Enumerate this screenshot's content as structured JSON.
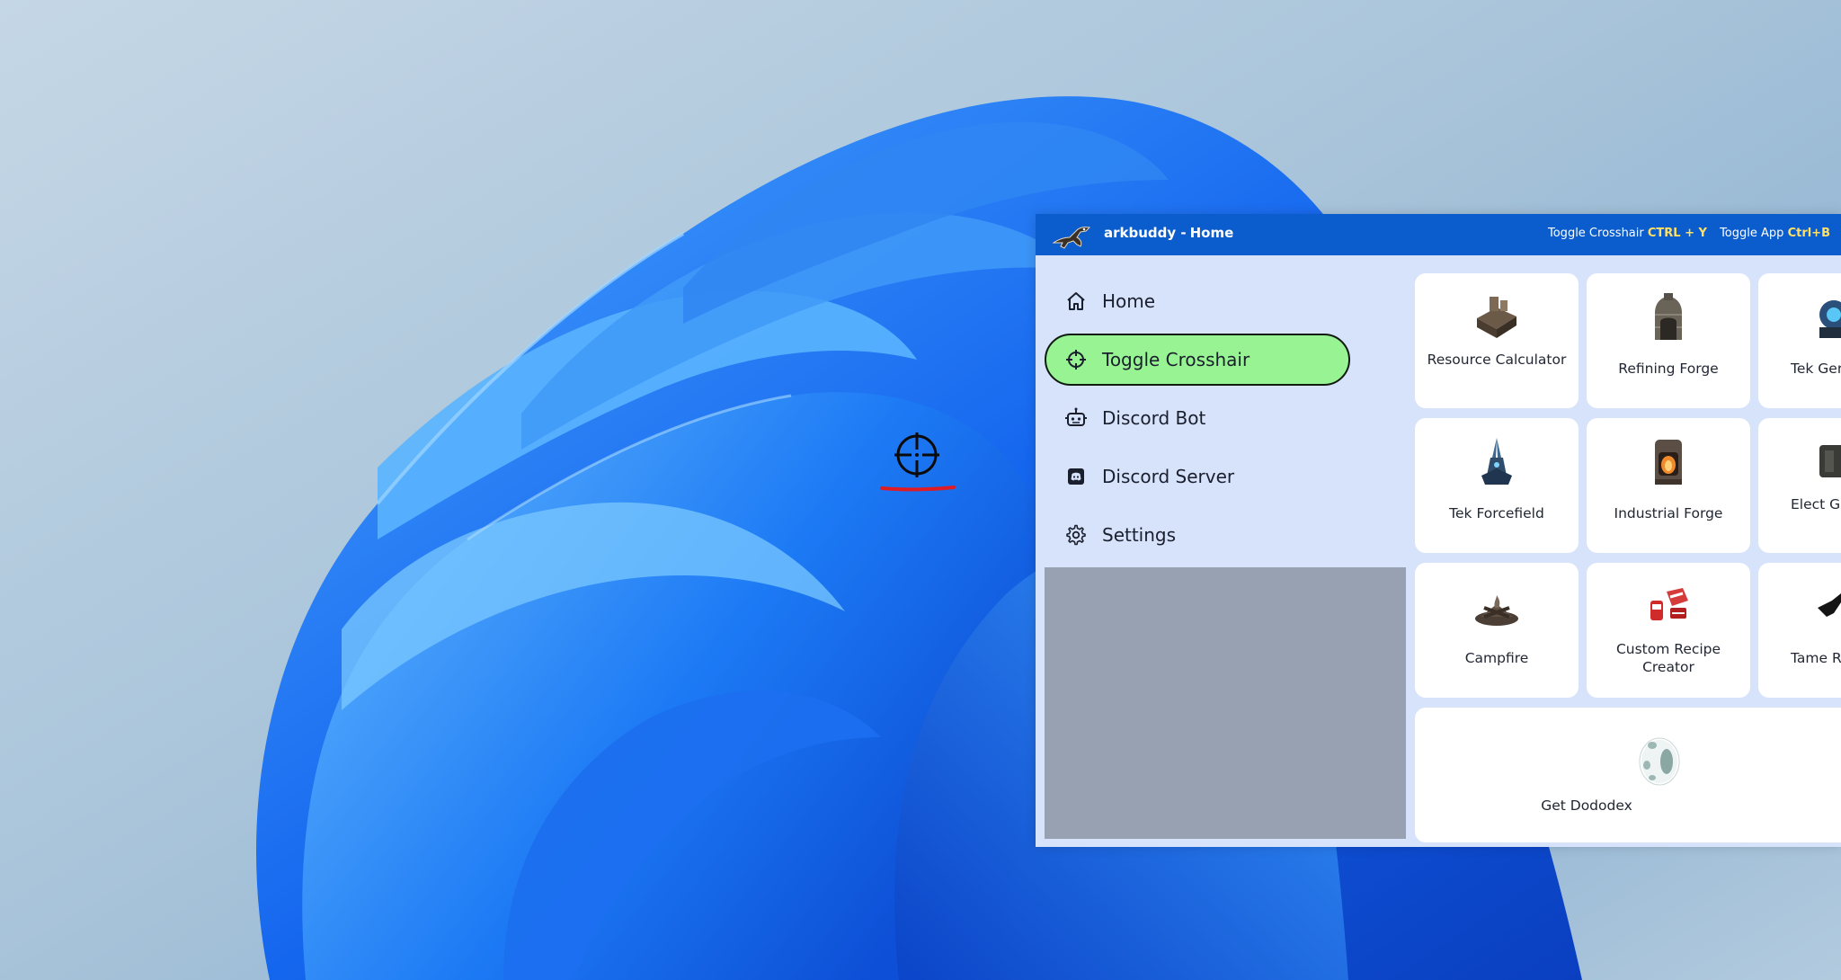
{
  "titlebar": {
    "app_name": "arkbuddy -",
    "page_name": "Home",
    "hint_crosshair_label": "Toggle Crosshair",
    "hint_crosshair_key": "CTRL + Y",
    "hint_app_label": "Toggle App",
    "hint_app_key": "Ctrl+B"
  },
  "nav": {
    "items": [
      {
        "label": "Home",
        "icon": "home-icon"
      },
      {
        "label": "Toggle Crosshair",
        "icon": "crosshair-icon",
        "active": true
      },
      {
        "label": "Discord Bot",
        "icon": "robot-icon"
      },
      {
        "label": "Discord Server",
        "icon": "discord-icon"
      },
      {
        "label": "Settings",
        "icon": "gear-icon"
      }
    ]
  },
  "tiles": [
    {
      "label": "Resource Calculator",
      "icon": "resource-calculator-icon"
    },
    {
      "label": "Refining Forge",
      "icon": "refining-forge-icon"
    },
    {
      "label": "Tek Ger",
      "icon": "tek-generator-icon"
    },
    {
      "label": "Tek Forcefield",
      "icon": "tek-forcefield-icon"
    },
    {
      "label": "Industrial Forge",
      "icon": "industrial-forge-icon"
    },
    {
      "label": "Elect Gene",
      "icon": "electrical-generator-icon"
    },
    {
      "label": "Campfire",
      "icon": "campfire-icon"
    },
    {
      "label": "Custom Recipe Creator",
      "icon": "custom-recipe-icon"
    },
    {
      "label": "Tame R",
      "icon": "tame-icon"
    }
  ],
  "dododex": {
    "label": "Get Dododex",
    "icon": "dododex-egg-icon"
  },
  "colors": {
    "titlebar": "#0b5ccc",
    "app_background": "#d7e3fb",
    "active_nav": "#98f492",
    "hint_key": "#ffe066",
    "underline": "#e01b24"
  }
}
